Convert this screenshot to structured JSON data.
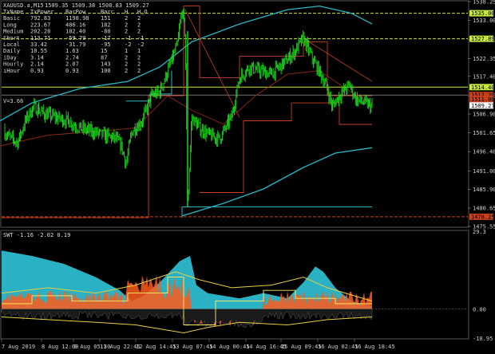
{
  "chart_window": {
    "symbol_label": "XAUUSD.a,M15",
    "ohlc_label": "1509.35 1509.38 1508.83 1509.27",
    "indicator_label": "SWT -1.16 -2.02 0.19",
    "v_label": "V=3.66"
  },
  "colors": {
    "background": "#000000",
    "candles": "#19e019",
    "channel": "#27b8c8",
    "resistance": "#c8401c",
    "support": "#8c2a12",
    "level_line": "#c8e640",
    "step_line": "#3fb0c8",
    "grid": "#3a3a3a"
  },
  "info_table": {
    "headers": [
      "TxName",
      "TxPower",
      "BarPow",
      "Barc",
      "H",
      "H_O"
    ],
    "rows": [
      [
        "Basic",
        "792.83",
        "1198.98",
        "151",
        "2",
        "2"
      ],
      [
        "Long",
        "223.67",
        "486.16",
        "182",
        "2",
        "2"
      ],
      [
        "Medium",
        "202.28",
        "182.40",
        "-80",
        "2",
        "2"
      ],
      [
        "Short",
        "113.71",
        "-59.79",
        "-17",
        "-1",
        "-1"
      ],
      [
        "Local",
        "33.42",
        "-31.79",
        "-95",
        "-2",
        "-2"
      ],
      [
        "Daily",
        "10.55",
        "1.63",
        "15",
        "1",
        "1"
      ],
      [
        "iDay",
        "3.14",
        "2.74",
        "87",
        "2",
        "2"
      ],
      [
        "Hourly",
        "2.14",
        "2.07",
        "143",
        "2",
        "2"
      ],
      [
        "iHour",
        "0.93",
        "0.93",
        "100",
        "2",
        "2"
      ]
    ]
  },
  "chart_data": [
    {
      "type": "candlestick",
      "ylim": [
        1475.55,
        1538.25
      ],
      "y_ticks": [
        1538.25,
        1533.0,
        1527.6,
        1522.35,
        1517.4,
        1512.0,
        1506.9,
        1501.65,
        1496.4,
        1491.0,
        1485.9,
        1480.65,
        1475.55
      ],
      "x_ticks": [
        "7 Aug 2019",
        "8 Aug 12:00",
        "9 Aug 05:30",
        "11 Aug 22:45",
        "12 Aug 14:45",
        "13 Aug 07:45",
        "14 Aug 00:45",
        "14 Aug 16:45",
        "15 Aug 09:45",
        "16 Aug 02:45",
        "16 Aug 18:45"
      ],
      "price_tags": [
        {
          "label": "1535.00",
          "color": "#c8e640"
        },
        {
          "label": "1527.89",
          "color": "#c8e640"
        },
        {
          "label": "1514.40",
          "color": "#c8e640"
        },
        {
          "label": "1512.20",
          "color": "#c8401c"
        },
        {
          "label": "1511.00",
          "color": "#c8401c"
        },
        {
          "label": "1509.27",
          "color": "#ffffff"
        },
        {
          "label": "1478.25",
          "color": "#c8401c"
        }
      ],
      "levels": [
        1535.0,
        1527.89,
        1514.4,
        1478.25
      ],
      "current_price": 1509.27
    },
    {
      "type": "area",
      "name": "SWT",
      "ylim": [
        -10.95,
        29.3
      ],
      "y_ticks": [
        29.3,
        0.0,
        -10.95
      ],
      "values": [
        -1.16,
        -2.02,
        0.19
      ]
    }
  ]
}
